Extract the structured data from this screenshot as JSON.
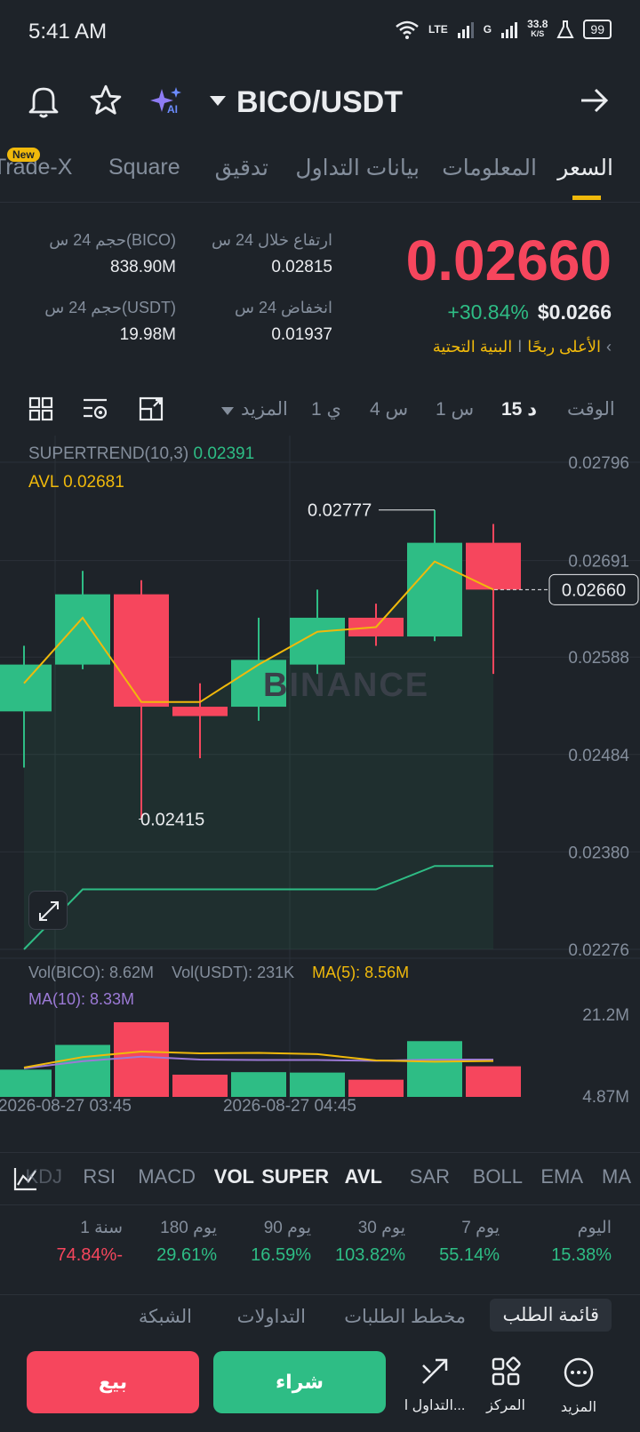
{
  "status": {
    "time": "5:41 AM",
    "net1": "LTE",
    "net2": "G",
    "speed": "33.8",
    "speed_unit": "K/S",
    "battery": "99"
  },
  "header": {
    "pair": "BICO/USDT",
    "ai_label": "AI"
  },
  "tabs": [
    {
      "label": "السعر",
      "active": true
    },
    {
      "label": "المعلومات"
    },
    {
      "label": "بيانات التداول"
    },
    {
      "label": "تدقيق"
    },
    {
      "label": "Square"
    },
    {
      "label": "Trade-X",
      "badge": "New"
    }
  ],
  "price": {
    "last": "0.02660",
    "change_pct": "+30.84%",
    "usd": "$0.0266",
    "tag1": "البنية التحتية",
    "tag2": "الأعلى ربحًا",
    "high_label": "ارتفاع خلال 24 س",
    "high_val": "0.02815",
    "low_label": "انخفاض 24 س",
    "low_val": "0.01937",
    "vol_base_label": "حجم 24 س(BICO)",
    "vol_base_val": "838.90M",
    "vol_quote_label": "حجم 24 س(USDT)",
    "vol_quote_val": "19.98M"
  },
  "intervals": {
    "time_label": "الوقت",
    "i15m": "15 د",
    "i1h": "1 س",
    "i4h": "4 س",
    "i1d": "1 ي",
    "more": "المزيد"
  },
  "chart": {
    "supertrend_label": "SUPERTREND(10,3)",
    "supertrend_val": "0.02391",
    "avl_label": "AVL",
    "avl_val": "0.02681",
    "high_marker": "0.02777",
    "low_marker": "0.02415",
    "current_price": "0.02660",
    "watermark": "BINANCE",
    "price_ticks": [
      "0.02796",
      "0.02691",
      "0.02588",
      "0.02484",
      "0.02380",
      "0.02276"
    ],
    "vol_base": "Vol(BICO): 8.62M",
    "vol_quote": "Vol(USDT): 231K",
    "ma5": "MA(5): 8.56M",
    "ma10": "MA(10): 8.33M",
    "vol_ticks": [
      "21.2M",
      "4.87M"
    ],
    "time_ticks": [
      "2026-08-27 03:45",
      "2026-08-27 04:45"
    ]
  },
  "chart_data": {
    "type": "candlestick",
    "y_range": [
      0.02276,
      0.02796
    ],
    "candles": [
      {
        "o": 0.0253,
        "h": 0.026,
        "l": 0.0247,
        "c": 0.0258
      },
      {
        "o": 0.0258,
        "h": 0.0268,
        "l": 0.02575,
        "c": 0.02655
      },
      {
        "o": 0.02655,
        "h": 0.0267,
        "l": 0.02415,
        "c": 0.02535
      },
      {
        "o": 0.02535,
        "h": 0.0256,
        "l": 0.0248,
        "c": 0.02525
      },
      {
        "o": 0.02535,
        "h": 0.0263,
        "l": 0.0252,
        "c": 0.02585
      },
      {
        "o": 0.0258,
        "h": 0.0266,
        "l": 0.0257,
        "c": 0.0263
      },
      {
        "o": 0.0263,
        "h": 0.02645,
        "l": 0.026,
        "c": 0.0261
      },
      {
        "o": 0.0261,
        "h": 0.02745,
        "l": 0.02605,
        "c": 0.0271
      },
      {
        "o": 0.0271,
        "h": 0.0273,
        "l": 0.0257,
        "c": 0.0266
      }
    ],
    "avl": [
      0.0256,
      0.0263,
      0.0254,
      0.0254,
      0.0258,
      0.02615,
      0.0262,
      0.0269,
      0.0266
    ],
    "supertrend": [
      0.02276,
      0.0234,
      0.0234,
      0.0234,
      0.0234,
      0.0234,
      0.0234,
      0.02365,
      0.02365
    ],
    "volumes": [
      6.5,
      12.4,
      17.8,
      5.3,
      5.9,
      5.8,
      4.1,
      13.3,
      7.3
    ],
    "vol_range": [
      0,
      21.2
    ]
  },
  "indicators": [
    "MA",
    "EMA",
    "BOLL",
    "SAR",
    "AVL",
    "SUPER",
    "VOL",
    "MACD",
    "RSI",
    "KDJ"
  ],
  "indicators_on": [
    "AVL",
    "SUPER",
    "VOL"
  ],
  "performance": [
    {
      "label": "اليوم",
      "value": "15.38%",
      "up": true
    },
    {
      "label": "7 يوم",
      "value": "55.14%",
      "up": true
    },
    {
      "label": "30 يوم",
      "value": "103.82%",
      "up": true
    },
    {
      "label": "90 يوم",
      "value": "16.59%",
      "up": true
    },
    {
      "label": "180 يوم",
      "value": "29.61%",
      "up": true
    },
    {
      "label": "1 سنة",
      "value": "74.84%-",
      "up": false
    }
  ],
  "bottom_tabs": [
    "قائمة الطلب",
    "مخطط الطلبات",
    "التداولات",
    "الشبكة"
  ],
  "actions": {
    "more": "المزيد",
    "center": "المركز",
    "trade": "التداول ا...",
    "buy": "شراء",
    "sell": "بيع"
  },
  "colors": {
    "up": "#2ebd85",
    "down": "#f6465d",
    "accent": "#f0b90b",
    "bg": "#1e2329"
  }
}
